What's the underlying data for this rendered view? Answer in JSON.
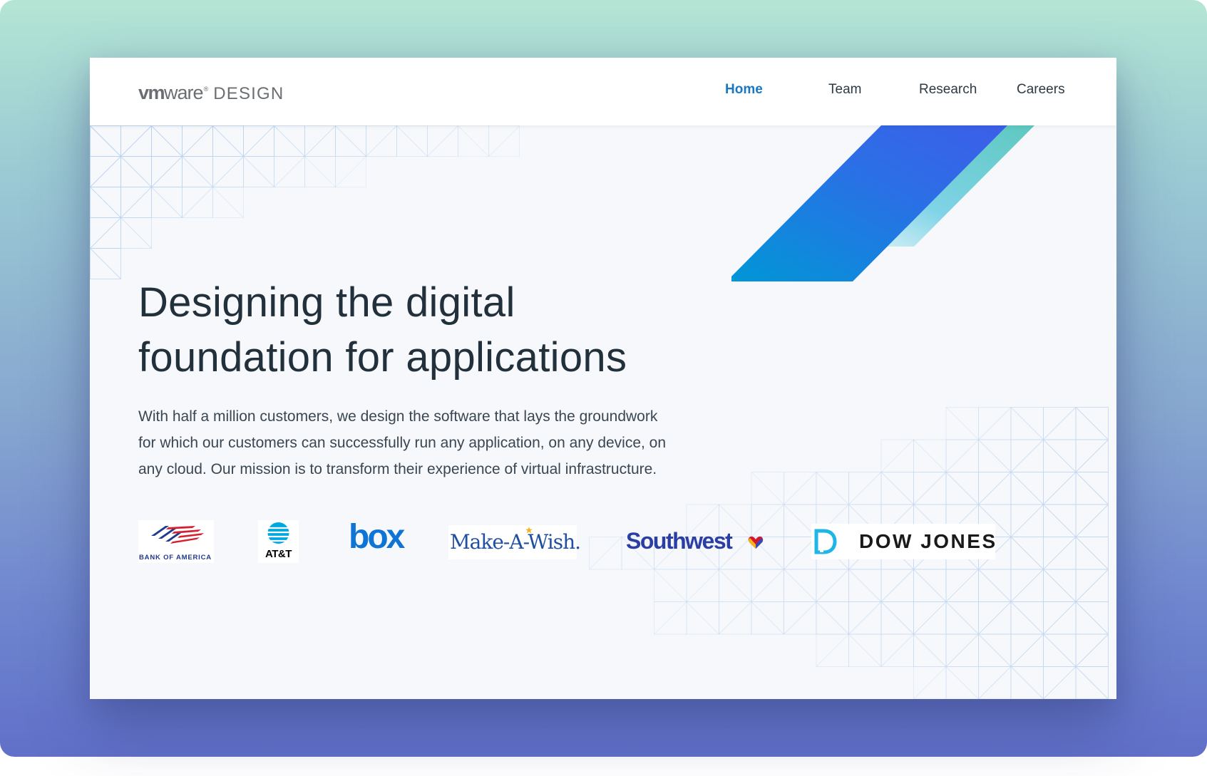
{
  "brand": {
    "bold": "vm",
    "light": "ware",
    "reg": "®",
    "suffix": "DESIGN"
  },
  "nav": [
    {
      "label": "Home",
      "active": true
    },
    {
      "label": "Team",
      "active": false
    },
    {
      "label": "Research",
      "active": false
    },
    {
      "label": "Careers",
      "active": false
    }
  ],
  "hero": {
    "title_lines": [
      "Designing the digital",
      "foundation for applications"
    ],
    "body_lines": [
      "With half a million customers, we design the software that lays the groundwork",
      "for which our customers can successfully run any application, on any device, on",
      "any cloud. Our mission is to transform their experience of virtual infrastructure."
    ]
  },
  "customers": {
    "bank_of_america": "BANK OF AMERICA",
    "att": "AT&T",
    "box": "box",
    "make_a_wish": "Make-A-Wish.",
    "southwest": "Southwest",
    "dow_jones": "DOW JONES"
  },
  "colors": {
    "accent": "#1a78c2",
    "heading": "#22303b",
    "body": "#3a4652",
    "stripe_blue": "#3d5ee8",
    "stripe_cyan": "#0097d6",
    "stripe_teal": "#5ec8c0"
  }
}
